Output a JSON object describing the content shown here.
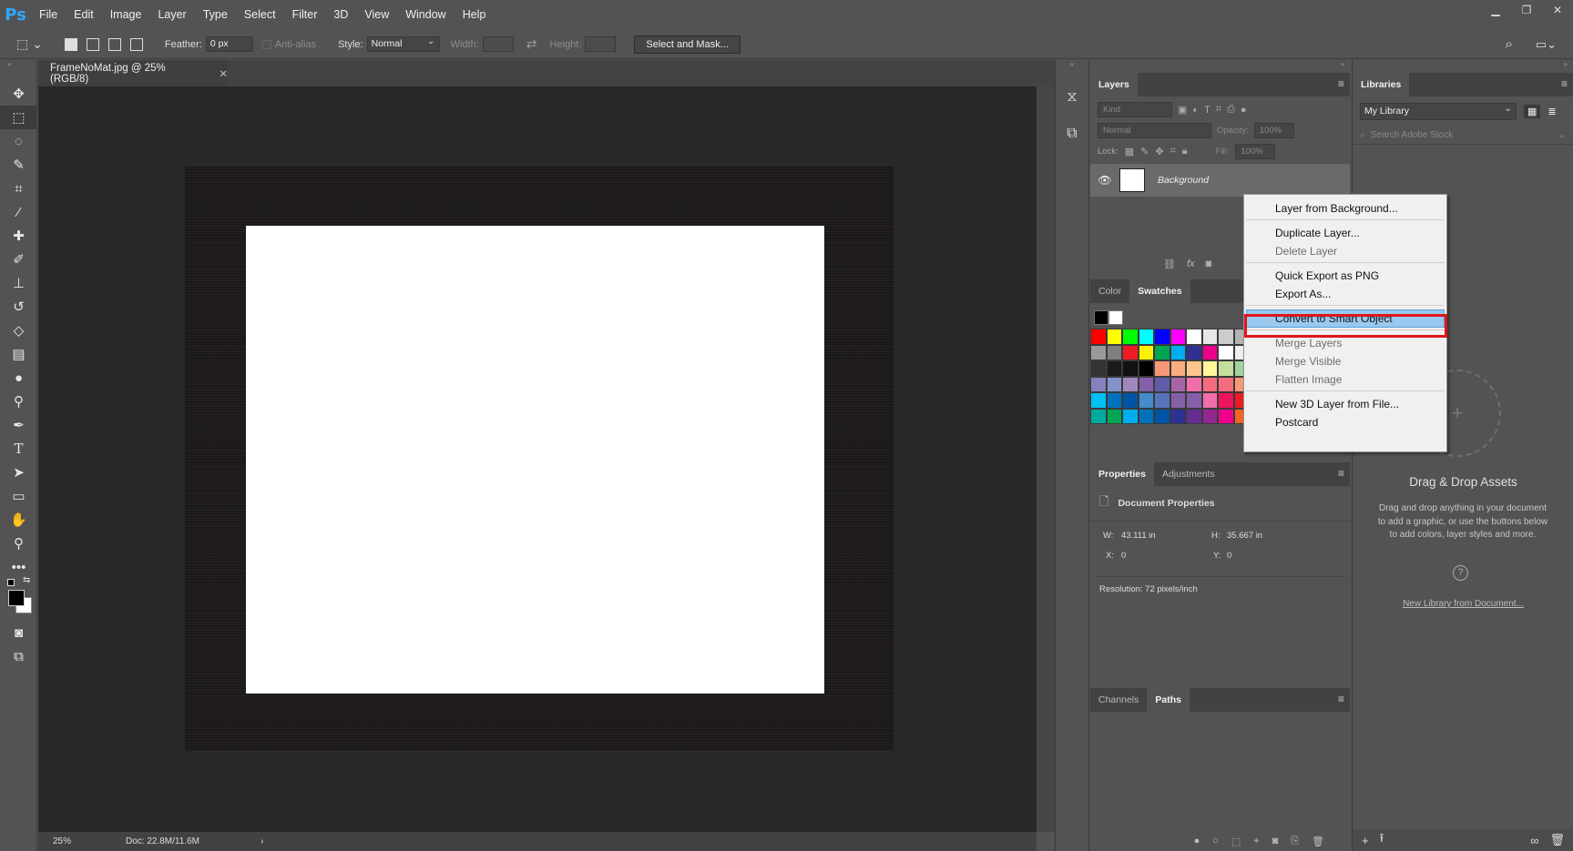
{
  "menubar": {
    "logo": "Ps",
    "items": [
      "File",
      "Edit",
      "Image",
      "Layer",
      "Type",
      "Select",
      "Filter",
      "3D",
      "View",
      "Window",
      "Help"
    ]
  },
  "options": {
    "feather_label": "Feather:",
    "feather_value": "0 px",
    "antialias_label": "Anti-alias",
    "style_label": "Style:",
    "style_value": "Normal",
    "width_label": "Width:",
    "height_label": "Height:",
    "select_mask_label": "Select and Mask..."
  },
  "document": {
    "tab_title": "FrameNoMat.jpg @ 25% (RGB/8)",
    "zoom": "25%",
    "doc_size": "Doc: 22.8M/11.6M"
  },
  "layers_panel": {
    "tab": "Layers",
    "kind_placeholder": "Kind",
    "blend_mode": "Normal",
    "opacity_label": "Opacity:",
    "opacity_value": "100%",
    "lock_label": "Lock:",
    "fill_label": "Fill:",
    "fill_value": "100%",
    "layer_name": "Background"
  },
  "color_panel": {
    "tabs": [
      "Color",
      "Swatches"
    ],
    "swatch_rows": [
      [
        "#ff0000",
        "#ffff00",
        "#00ff00",
        "#00ffff",
        "#0000ff",
        "#ff00ff",
        "#ffffff",
        "#e6e6e6",
        "#cccccc",
        "#b3b3b3"
      ],
      [
        "#999999",
        "#808080",
        "#ed1c24",
        "#fff200",
        "#00a651",
        "#00aeef",
        "#2e3192",
        "#ec008c",
        "#ffffff",
        "#eeeeee"
      ],
      [
        "#333333",
        "#1a1a1a",
        "#111111",
        "#000000",
        "#f7977a",
        "#f9ad81",
        "#fdc68a",
        "#fff79a",
        "#c4df9b",
        "#a3d39c"
      ],
      [
        "#8781bd",
        "#8393ca",
        "#a187be",
        "#8560a8",
        "#605ca8",
        "#a864a8",
        "#f06eaa",
        "#f26c7d",
        "#f26d7d",
        "#f7977a"
      ],
      [
        "#00bff3",
        "#0072bc",
        "#0054a6",
        "#448ccb",
        "#5674b9",
        "#8560a8",
        "#855fa8",
        "#f06ea9",
        "#ed145b",
        "#ed1c24"
      ],
      [
        "#00a99d",
        "#00a651",
        "#00aeef",
        "#0072bc",
        "#0054a6",
        "#2e3192",
        "#662d91",
        "#92278f",
        "#ec008c",
        "#f26522"
      ]
    ]
  },
  "properties_panel": {
    "tabs": [
      "Properties",
      "Adjustments"
    ],
    "title": "Document Properties",
    "w_label": "W:",
    "w_value": "43.111 in",
    "h_label": "H:",
    "h_value": "35.667 in",
    "x_label": "X:",
    "x_value": "0",
    "y_label": "Y:",
    "y_value": "0",
    "resolution": "Resolution: 72 pixels/inch"
  },
  "channels_panel": {
    "tabs": [
      "Channels",
      "Paths"
    ]
  },
  "libraries_panel": {
    "tab": "Libraries",
    "library": "My Library",
    "search_placeholder": "Search Adobe Stock",
    "drag_title": "Drag & Drop Assets",
    "drag_desc": "Drag and drop anything in your document to add a graphic, or use the buttons below to add colors, layer styles and more.",
    "new_lib_link": "New Library from Document..."
  },
  "context_menu": {
    "items": [
      {
        "label": "Layer from Background...",
        "disabled": false
      },
      {
        "label": "Duplicate Layer...",
        "disabled": false
      },
      {
        "label": "Delete Layer",
        "disabled": true
      },
      {
        "label": "Quick Export as PNG",
        "disabled": false
      },
      {
        "label": "Export As...",
        "disabled": false
      },
      {
        "label": "Convert to Smart Object",
        "disabled": false,
        "highlighted": true
      },
      {
        "label": "Merge Layers",
        "disabled": true
      },
      {
        "label": "Merge Visible",
        "disabled": true
      },
      {
        "label": "Flatten Image",
        "disabled": true
      },
      {
        "label": "New 3D Layer from File...",
        "disabled": false
      },
      {
        "label": "Postcard",
        "disabled": false
      }
    ]
  },
  "colors": {
    "highlight": "#99c9ef",
    "annotation_red": "#e0151c",
    "ps_blue": "#31a8ff"
  }
}
